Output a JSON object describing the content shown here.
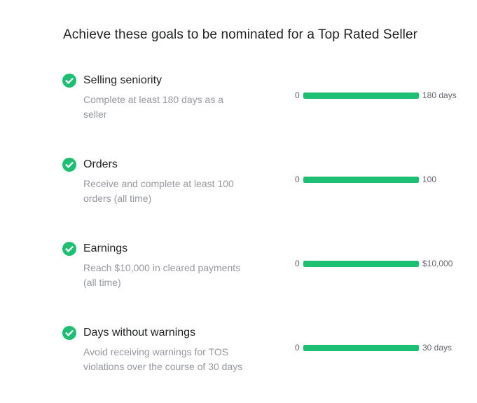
{
  "title": "Achieve these goals to be nominated for a Top Rated Seller",
  "accent_color": "#1dbf73",
  "goals": [
    {
      "name": "Selling seniority",
      "description": "Complete at least 180 days as a seller",
      "icon": "check-circle-icon",
      "bar_min": "0",
      "bar_max": "180 days",
      "progress": 1.0
    },
    {
      "name": "Orders",
      "description": "Receive and complete at least 100 orders (all time)",
      "icon": "check-circle-icon",
      "bar_min": "0",
      "bar_max": "100",
      "progress": 1.0
    },
    {
      "name": "Earnings",
      "description": "Reach $10,000 in cleared payments (all time)",
      "icon": "check-circle-icon",
      "bar_min": "0",
      "bar_max": "$10,000",
      "progress": 1.0
    },
    {
      "name": "Days without warnings",
      "description": "Avoid receiving warnings for TOS violations over the course of 30 days",
      "icon": "check-circle-icon",
      "bar_min": "0",
      "bar_max": "30 days",
      "progress": 1.0
    }
  ]
}
